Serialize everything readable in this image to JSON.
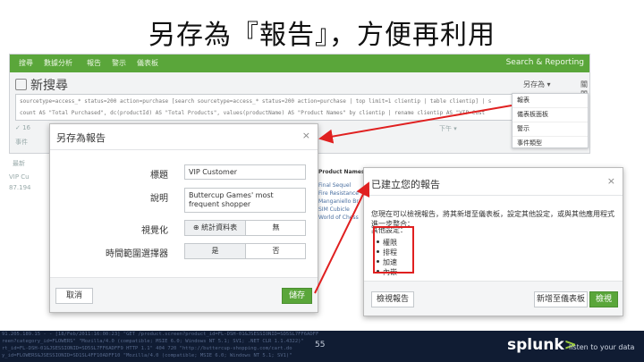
{
  "slide": {
    "title": "另存為『報告』，方便再利用",
    "page_number": "55"
  },
  "app": {
    "nav": [
      "搜尋",
      "數據分析",
      "報告",
      "警示",
      "儀表板"
    ],
    "brand": "Search & Reporting",
    "page_title": "新搜尋",
    "query_line1": "sourcetype=access_* status=200 action=purchase [search sourcetype=access_* status=200 action=purchase | top limit=1 clientip | table clientip] | s",
    "query_line2": "count AS \"Total Purchased\", dc(productId) AS \"Total Products\", values(productName) AS \"Product Names\" by clientip | rename clientip AS \"VIP Cust",
    "save_as_label": "另存為 ▾",
    "close_label": "關閉",
    "faint_left_1": "✓ 16",
    "faint_left_2": "事件",
    "faint_left_3": "最新",
    "faint_left_4": "VIP Cu",
    "faint_left_5": "87.194",
    "faint_mid": "下午 ▾"
  },
  "dropdown": {
    "items": [
      "報表",
      "儀表板面板",
      "警示",
      "事件類型"
    ]
  },
  "save_dialog": {
    "title": "另存為報告",
    "close_icon": "×",
    "fields": {
      "title_label": "標題",
      "title_value": "VIP Customer",
      "description_label": "說明",
      "description_value": "Buttercup Games' most frequent shopper",
      "visualization_label": "視覺化",
      "visualization_options": [
        "⊕ 統計資料表",
        "無"
      ],
      "time_picker_label": "時間範圍選擇器",
      "time_picker_options": [
        "是",
        "否"
      ]
    },
    "cancel_label": "取消",
    "save_label": "儲存"
  },
  "table_peek": {
    "header": "Product Names",
    "rows": [
      "Final Sequel",
      "Fire Resistance",
      "Manganiello Br",
      "SIM Cubicle",
      "World of Chess"
    ]
  },
  "created_dialog": {
    "title": "已建立您的報告",
    "close_icon": "×",
    "message": "您現在可以檢視報告，將其新增至儀表板，設定其他設定，或與其他應用程式進一步整合：",
    "settings_label": "其他設定：",
    "settings": [
      "權限",
      "排程",
      "加速",
      "內嵌"
    ],
    "view_label": "檢視報告",
    "add_dashboard_label": "新增至儀表板",
    "view_button_label": "檢視"
  },
  "banner": {
    "log_lines": [
      "91.205.189.15 - - [18/Feb/2011:16:00:23] \"GET /product.screen?product_id=FL-DSH-01&JSESSIONID=SD5SL7FF6ADFF",
      "reen?category_id=FLOWERS\" \"Mozilla/4.0 (compatible; MSIE 6.0; Windows NT 5.1; SV1; .NET CLR 1.1.4322)\"",
      "rt_id=FL-DSH-01&JSESSIONID=SD5SL7FF6ADFF9 HTTP 1.1\" 404 720 \"http://buttercup-shopping.com/cart.do",
      "y_id=FLOWERS&JSESSIONID=SD1SL4FF10ADFF10 \"Mozilla/4.0 (compatible; MSIE 6.0; Windows NT 5.1; SV1)\""
    ],
    "logo": "splunk",
    "logo_mark": ">",
    "tagline": "listen to your data"
  },
  "colors": {
    "nav_green": "#5aa63a",
    "banner_navy": "#101c33",
    "highlight_red": "#e02020"
  }
}
